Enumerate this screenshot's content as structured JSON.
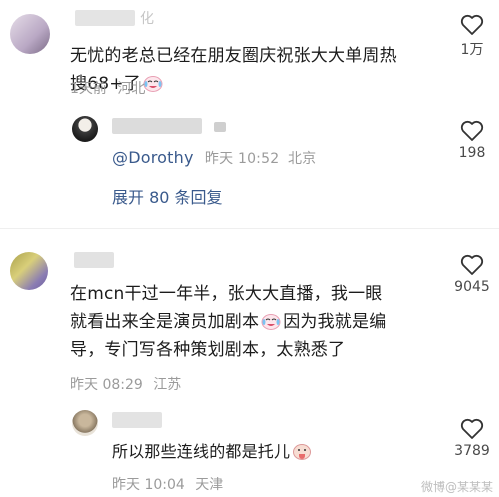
{
  "comments": [
    {
      "username_fragment": "化",
      "text_line1": "无忧的老总已经在朋友圈庆祝张大大单周热",
      "text_line2": "搜68+了",
      "time": "1天前",
      "location": "河北",
      "likes": "1万"
    },
    {
      "mention": "@Dorothy",
      "time": "昨天 10:52",
      "location": "北京",
      "likes": "198",
      "expand_label": "展开 80 条回复"
    },
    {
      "text_line1": "在mcn干过一年半，张大大直播，我一眼",
      "text_line2a": "就看出来全是演员加剧本",
      "text_line2b": "因为我就是编",
      "text_line3": "导，专门写各种策划剧本，太熟悉了",
      "time": "昨天 08:29",
      "location": "江苏",
      "likes": "9045"
    },
    {
      "text_line1": "所以那些连线的都是托儿",
      "time": "昨天 10:04",
      "location": "天津",
      "likes": "3789"
    }
  ],
  "watermark": "微博@某某某",
  "icons": {
    "like": "heart-outline-icon",
    "emoji": "cry-laugh-emoji-icon"
  }
}
